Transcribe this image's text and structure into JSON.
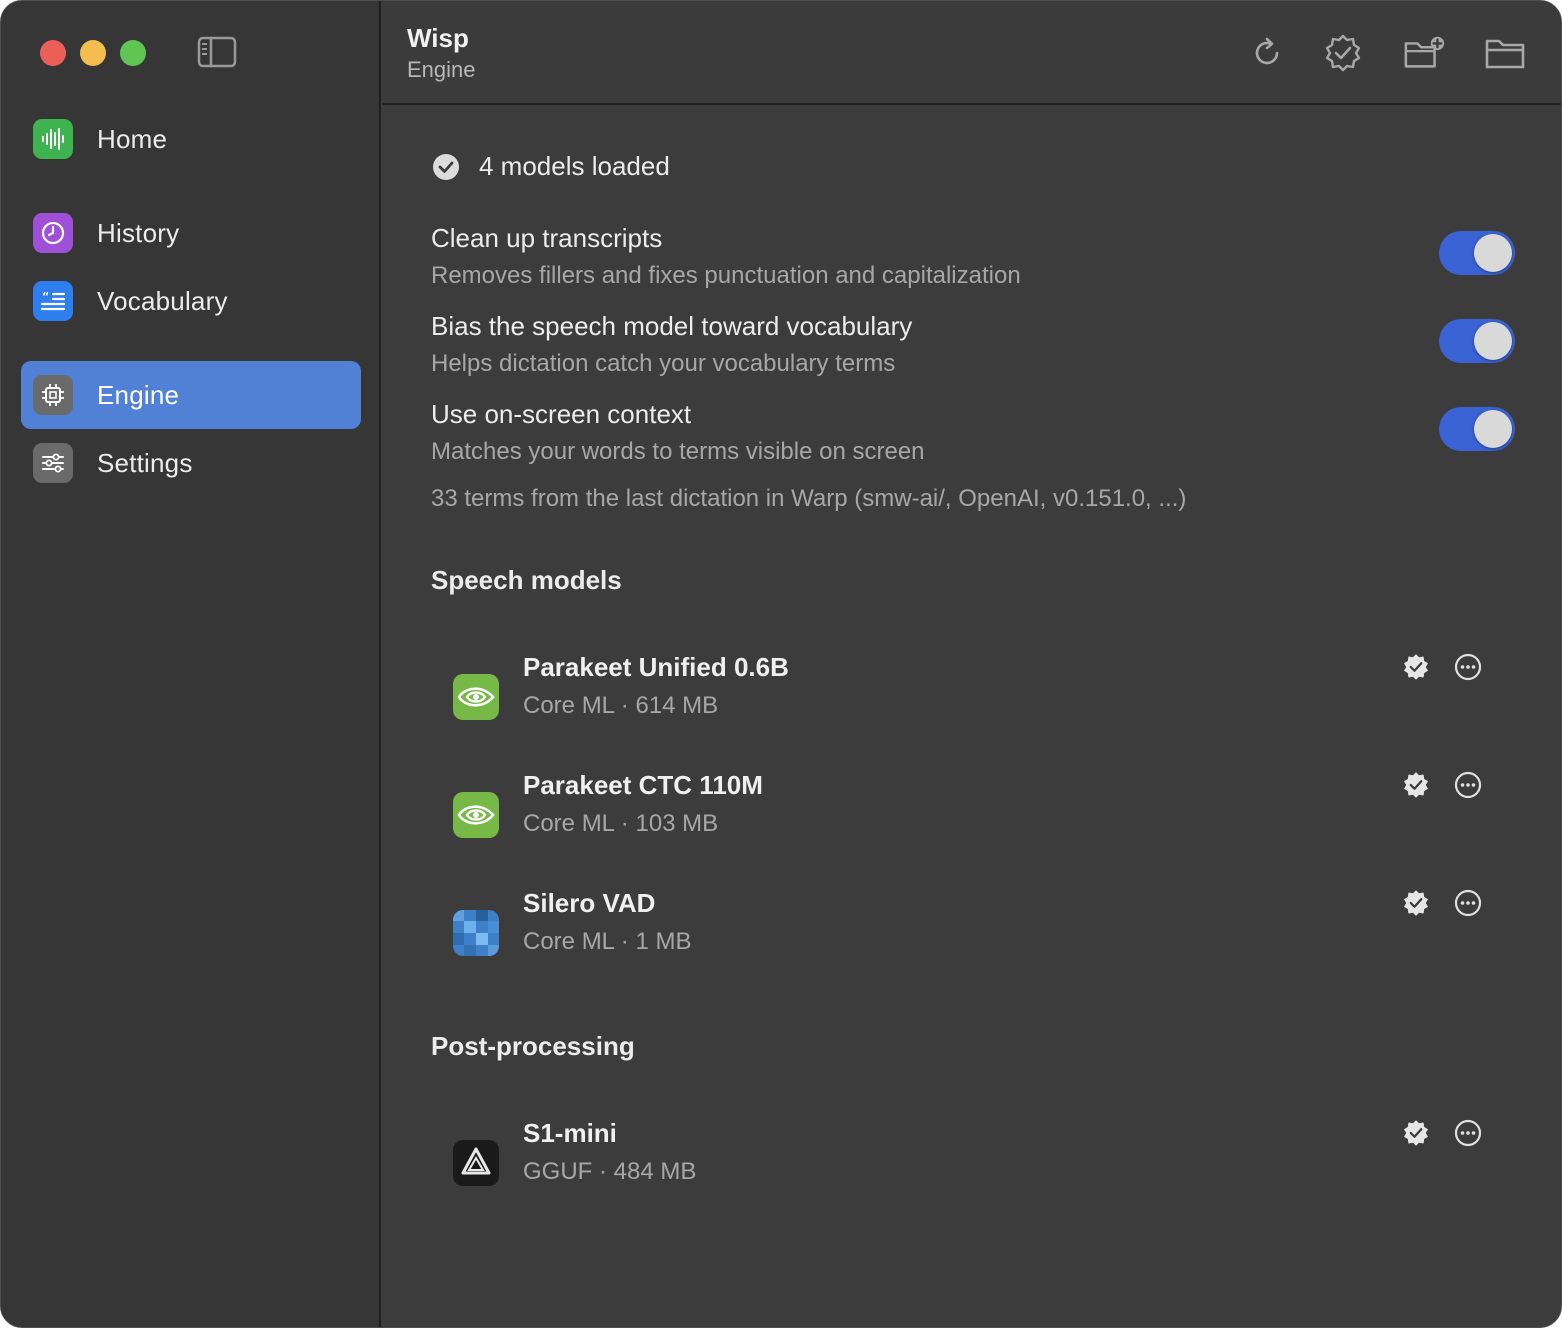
{
  "app": {
    "title": "Wisp",
    "subtitle": "Engine"
  },
  "sidebar": {
    "items": [
      {
        "label": "Home",
        "icon": "waveform-icon",
        "color": "#3fb34f",
        "active": false
      },
      {
        "label": "History",
        "icon": "clock-icon",
        "color": "#a04fd8",
        "active": false
      },
      {
        "label": "Vocabulary",
        "icon": "quote-list-icon",
        "color": "#2f7ef0",
        "active": false
      },
      {
        "label": "Engine",
        "icon": "chip-icon",
        "color": "#6a6a6a",
        "active": true
      },
      {
        "label": "Settings",
        "icon": "sliders-icon",
        "color": "#6a6a6a",
        "active": false
      }
    ]
  },
  "toolbar": {
    "buttons": [
      "refresh-icon",
      "verified-badge-icon",
      "add-folder-icon",
      "folder-icon"
    ]
  },
  "status": {
    "text": "4 models loaded"
  },
  "settings": [
    {
      "title": "Clean up transcripts",
      "description": "Removes fillers and fixes punctuation and capitalization",
      "enabled": true
    },
    {
      "title": "Bias the speech model toward vocabulary",
      "description": "Helps dictation catch your vocabulary terms",
      "enabled": true
    },
    {
      "title": "Use on-screen context",
      "description": "Matches your words to terms visible on screen",
      "enabled": true
    }
  ],
  "terms_note": "33 terms from the last dictation in Warp (smw-ai/, OpenAI, v0.151.0, ...)",
  "speech_models": {
    "title": "Speech models",
    "items": [
      {
        "name": "Parakeet Unified 0.6B",
        "meta": "Core ML · 614 MB",
        "icon": "nvidia-icon"
      },
      {
        "name": "Parakeet CTC 110M",
        "meta": "Core ML · 103 MB",
        "icon": "nvidia-icon"
      },
      {
        "name": "Silero VAD",
        "meta": "Core ML · 1 MB",
        "icon": "silero-icon"
      }
    ]
  },
  "post_processing": {
    "title": "Post-processing",
    "items": [
      {
        "name": "S1-mini",
        "meta": "GGUF · 484 MB",
        "icon": "s1-icon"
      }
    ]
  },
  "colors": {
    "accent": "#5081d6",
    "toggle_on": "#3a63d6",
    "background": "#3c3c3c",
    "sidebar": "#363636"
  }
}
